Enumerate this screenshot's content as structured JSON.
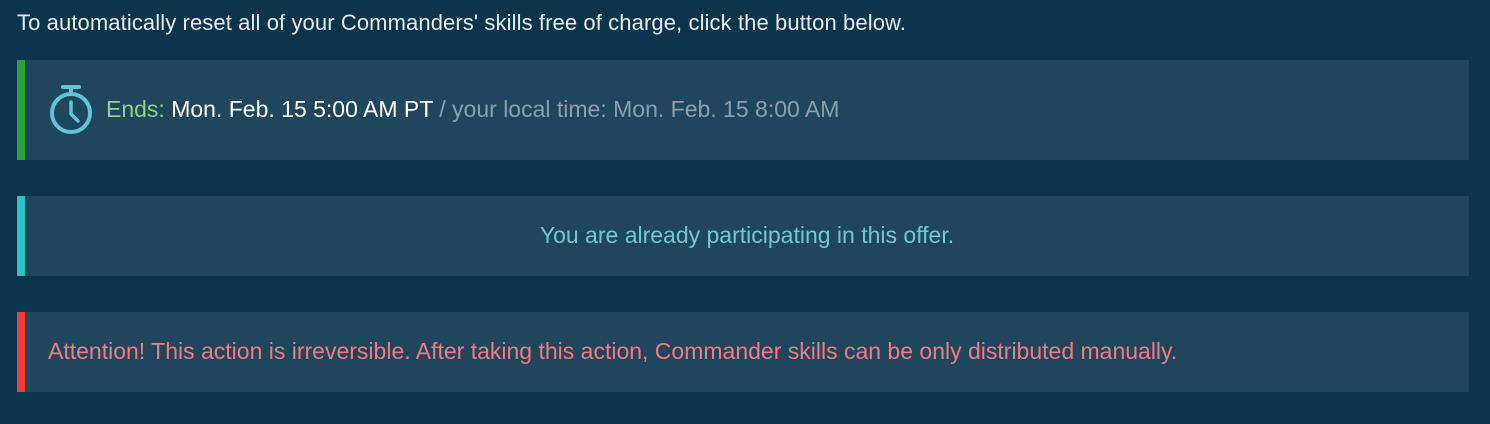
{
  "intro": {
    "text": "To automatically reset all of your Commanders' skills free of charge, click the button below."
  },
  "timer": {
    "icon": "stopwatch-icon",
    "ends_label": "Ends:",
    "ends_value": "Mon. Feb. 15 5:00 AM PT",
    "local_separator": " / your local time:",
    "local_value": "Mon. Feb. 15 8:00 AM",
    "accent_color": "#2e9e3a",
    "icon_color": "#5fc4d6"
  },
  "status": {
    "text": "You are already participating in this offer.",
    "accent_color": "#2ac2c9",
    "text_color": "#6fc9cf"
  },
  "attention": {
    "text": "Attention! This action is irreversible. After taking this action, Commander skills can be only distributed manually.",
    "accent_color": "#f03a3a",
    "text_color": "#f27a80"
  },
  "colors": {
    "background": "#0d344d",
    "panel": "#20465d"
  }
}
